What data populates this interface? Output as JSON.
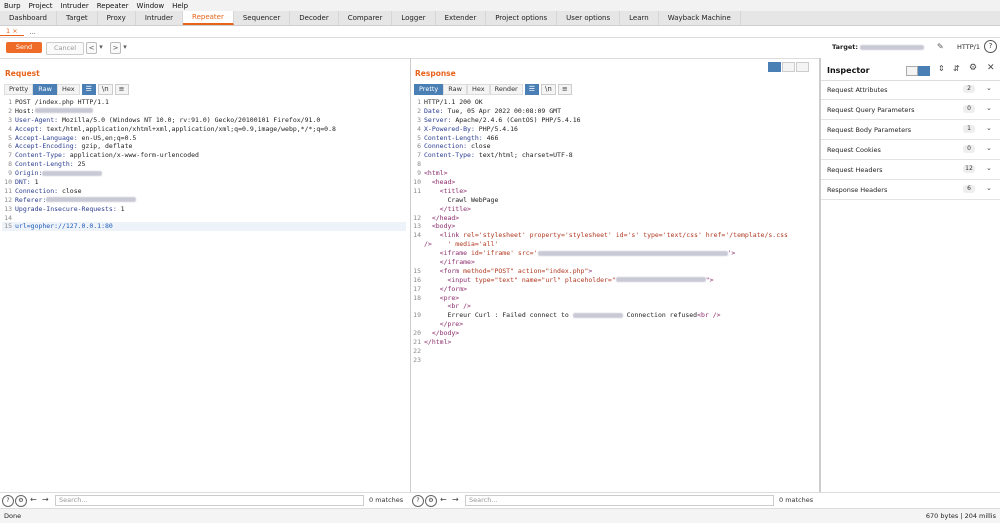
{
  "menu": [
    "Burp",
    "Project",
    "Intruder",
    "Repeater",
    "Window",
    "Help"
  ],
  "tabs": [
    "Dashboard",
    "Target",
    "Proxy",
    "Intruder",
    "Repeater",
    "Sequencer",
    "Decoder",
    "Comparer",
    "Logger",
    "Extender",
    "Project options",
    "User options",
    "Learn",
    "Wayback Machine"
  ],
  "active_tab": "Repeater",
  "subtabs": {
    "first": "1 ×",
    "second": "..."
  },
  "toolbar": {
    "send": "Send",
    "cancel": "Cancel",
    "back": "<",
    "back_menu": "▾",
    "forward": ">",
    "forward_menu": "▾",
    "target_label": "Target:",
    "protocol": "HTTP/1"
  },
  "request": {
    "title": "Request",
    "view_tabs": [
      "Pretty",
      "Raw",
      "Hex"
    ],
    "active_view": "Raw",
    "lines": [
      {
        "n": "1",
        "t": "POST /index.php HTTP/1.1"
      },
      {
        "n": "2",
        "t": "Host:"
      },
      {
        "n": "3",
        "k": "User-Agent:",
        "v": " Mozilla/5.0 (Windows NT 10.0; rv:91.0) Gecko/20100101 Firefox/91.0"
      },
      {
        "n": "4",
        "k": "Accept:",
        "v": " text/html,application/xhtml+xml,application/xml;q=0.9,image/webp,*/*;q=0.8"
      },
      {
        "n": "5",
        "k": "Accept-Language:",
        "v": " en-US,en;q=0.5"
      },
      {
        "n": "6",
        "k": "Accept-Encoding:",
        "v": " gzip, deflate"
      },
      {
        "n": "7",
        "k": "Content-Type:",
        "v": " application/x-www-form-urlencoded"
      },
      {
        "n": "8",
        "k": "Content-Length:",
        "v": " 25"
      },
      {
        "n": "9",
        "k": "Origin:",
        "v": ""
      },
      {
        "n": "10",
        "k": "DNT:",
        "v": " 1"
      },
      {
        "n": "11",
        "k": "Connection:",
        "v": " close"
      },
      {
        "n": "12",
        "k": "Referer:",
        "v": ""
      },
      {
        "n": "13",
        "k": "Upgrade-Insecure-Requests:",
        "v": " 1"
      },
      {
        "n": "14",
        "t": ""
      },
      {
        "n": "15",
        "u": "url=gopher://127.0.0.1:80"
      }
    ],
    "search_placeholder": "Search...",
    "matches": "0 matches"
  },
  "response": {
    "title": "Response",
    "view_tabs": [
      "Pretty",
      "Raw",
      "Hex",
      "Render"
    ],
    "active_view": "Pretty",
    "lines": [
      {
        "n": "1",
        "t": "HTTP/1.1 200 OK"
      },
      {
        "n": "2",
        "k": "Date:",
        "v": " Tue, 05 Apr 2022 00:08:09 GMT"
      },
      {
        "n": "3",
        "k": "Server:",
        "v": " Apache/2.4.6 (CentOS) PHP/5.4.16"
      },
      {
        "n": "4",
        "k": "X-Powered-By:",
        "v": " PHP/5.4.16"
      },
      {
        "n": "5",
        "k": "Content-Length:",
        "v": " 466"
      },
      {
        "n": "6",
        "k": "Connection:",
        "v": " close"
      },
      {
        "n": "7",
        "k": "Content-Type:",
        "v": " text/html; charset=UTF-8"
      },
      {
        "n": "8",
        "t": ""
      },
      {
        "n": "9",
        "g": "<html>"
      },
      {
        "n": "10",
        "g": "  <head>"
      },
      {
        "n": "11",
        "g": "    <title>"
      },
      {
        "n": "",
        "t": "      Crawl WebPage"
      },
      {
        "n": "",
        "g": "    </title>"
      },
      {
        "n": "12",
        "g": "  </head>"
      },
      {
        "n": "13",
        "g": "  <body>"
      },
      {
        "n": "14",
        "g": "    <link ",
        "a": "rel='stylesheet' property='stylesheet' id='s' type='text/css' href='/template/s.css"
      },
      {
        "n": "",
        "a": "    ' media='all' ",
        "g": "/>"
      },
      {
        "n": "",
        "g": "    <iframe ",
        "a": "id='iframe' src='",
        "g2": "'>"
      },
      {
        "n": "",
        "g": "    </iframe>"
      },
      {
        "n": "15",
        "g": "    <form ",
        "a": "method=\"POST\" action=\"index.php\"",
        "g2": ">"
      },
      {
        "n": "16",
        "g": "      <input ",
        "a": "type=\"text\" name=\"url\" placeholder=\"",
        "g2": "\">"
      },
      {
        "n": "17",
        "g": "    </form>"
      },
      {
        "n": "18",
        "g": "    <pre>"
      },
      {
        "n": "",
        "g": "      <br />"
      },
      {
        "n": "19",
        "t": "      Erreur Curl : Failed connect to ",
        "t2": " Connection refused",
        "g2": "<br />"
      },
      {
        "n": "",
        "g": "    </pre>"
      },
      {
        "n": "20",
        "g": "  </body>"
      },
      {
        "n": "21",
        "g": "</html>"
      },
      {
        "n": "22",
        "t": ""
      },
      {
        "n": "23",
        "t": ""
      }
    ],
    "search_placeholder": "Search...",
    "matches": "0 matches"
  },
  "inspector": {
    "title": "Inspector",
    "rows": [
      {
        "label": "Request Attributes",
        "count": "2"
      },
      {
        "label": "Request Query Parameters",
        "count": "0"
      },
      {
        "label": "Request Body Parameters",
        "count": "1"
      },
      {
        "label": "Request Cookies",
        "count": "0"
      },
      {
        "label": "Request Headers",
        "count": "12"
      },
      {
        "label": "Response Headers",
        "count": "6"
      }
    ]
  },
  "status": {
    "left": "Done",
    "right": "670 bytes | 204 millis"
  },
  "colors": {
    "accent": "#e8631a",
    "active_view": "#4a7fb5"
  }
}
